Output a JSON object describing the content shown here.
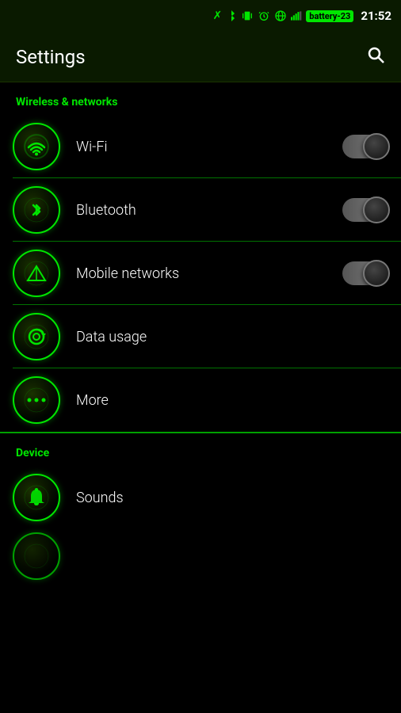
{
  "statusBar": {
    "time": "21:52",
    "icons": [
      "bluetooth",
      "vibrate",
      "alarm",
      "signal-globe",
      "signal-bars",
      "battery-23"
    ]
  },
  "header": {
    "title": "Settings",
    "searchLabel": "Search"
  },
  "sections": [
    {
      "id": "wireless",
      "title": "Wireless & networks",
      "items": [
        {
          "id": "wifi",
          "label": "Wi-Fi",
          "hasToggle": true,
          "toggleOn": true
        },
        {
          "id": "bluetooth",
          "label": "Bluetooth",
          "hasToggle": true,
          "toggleOn": true
        },
        {
          "id": "mobile-networks",
          "label": "Mobile networks",
          "hasToggle": true,
          "toggleOn": true
        },
        {
          "id": "data-usage",
          "label": "Data usage",
          "hasToggle": false
        },
        {
          "id": "more",
          "label": "More",
          "hasToggle": false
        }
      ]
    },
    {
      "id": "device",
      "title": "Device",
      "items": [
        {
          "id": "sounds",
          "label": "Sounds",
          "hasToggle": false
        }
      ]
    }
  ]
}
